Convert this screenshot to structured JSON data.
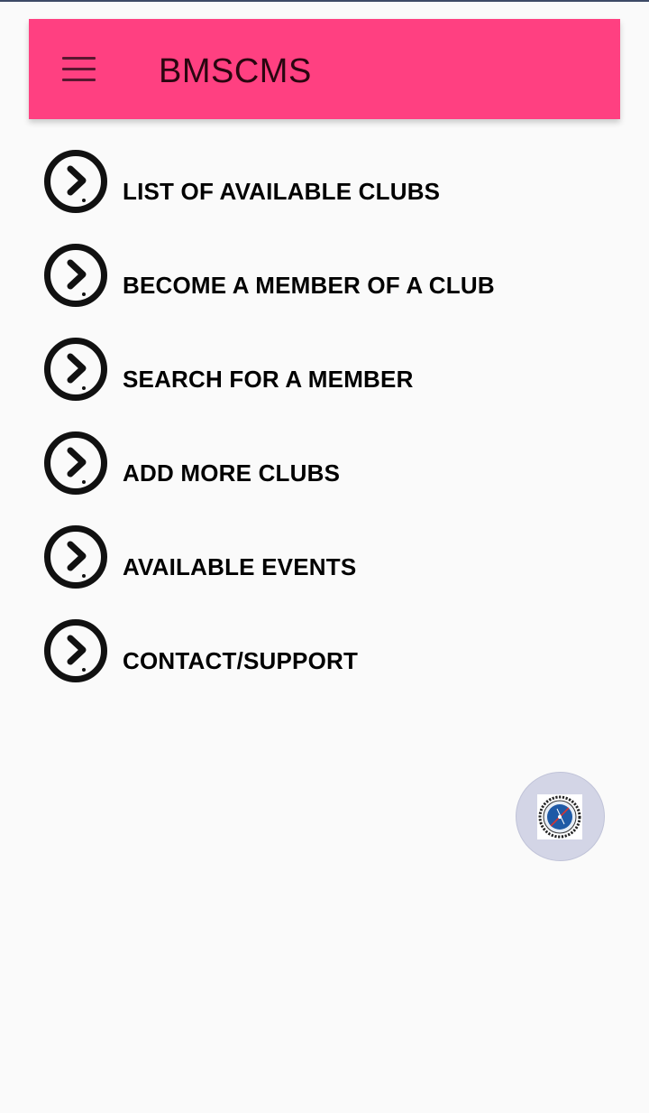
{
  "app": {
    "title": "BMSCMS",
    "accent_color": "#ff4081"
  },
  "header": {
    "menu_icon": "hamburger-menu-icon"
  },
  "menu": {
    "icon": "chevron-right-circle-icon",
    "items": [
      {
        "label": "LIST OF AVAILABLE CLUBS"
      },
      {
        "label": "BECOME A MEMBER OF A CLUB"
      },
      {
        "label": "SEARCH FOR A MEMBER"
      },
      {
        "label": "ADD MORE CLUBS"
      },
      {
        "label": "AVAILABLE EVENTS"
      },
      {
        "label": "CONTACT/SUPPORT"
      }
    ]
  },
  "fab": {
    "icon": "college-logo-icon"
  }
}
